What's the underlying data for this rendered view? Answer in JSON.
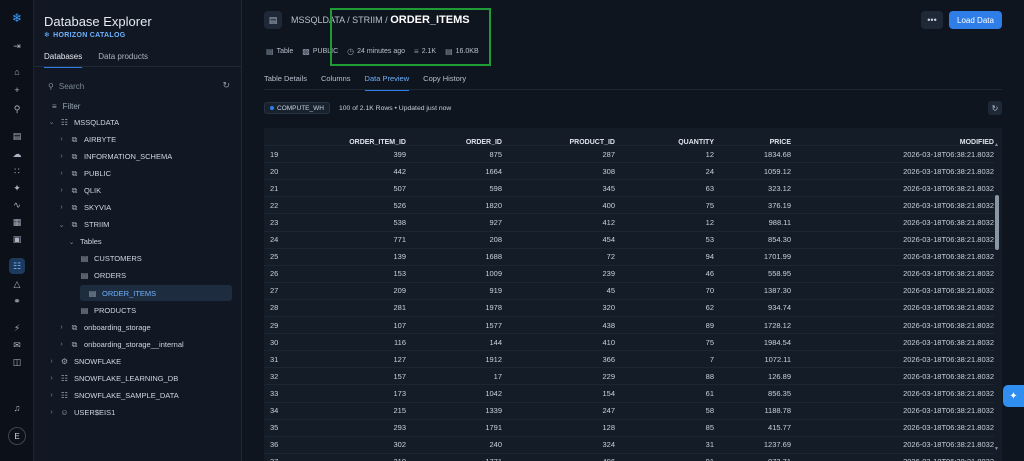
{
  "explorer": {
    "title": "Database Explorer",
    "catalog": "HORIZON CATALOG",
    "tabs": [
      "Databases",
      "Data products"
    ],
    "search_placeholder": "Search",
    "filter_label": "Filter",
    "tree": [
      {
        "label": "MSSQLDATA",
        "icon": "database-icon",
        "level": 0,
        "expanded": true
      },
      {
        "label": "AIRBYTE",
        "icon": "schema-icon",
        "level": 1,
        "expanded": false
      },
      {
        "label": "INFORMATION_SCHEMA",
        "icon": "schema-icon",
        "level": 1,
        "expanded": false
      },
      {
        "label": "PUBLIC",
        "icon": "schema-icon",
        "level": 1,
        "expanded": false
      },
      {
        "label": "QLIK",
        "icon": "schema-icon",
        "level": 1,
        "expanded": false
      },
      {
        "label": "SKYVIA",
        "icon": "schema-icon",
        "level": 1,
        "expanded": false
      },
      {
        "label": "STRIIM",
        "icon": "schema-icon",
        "level": 1,
        "expanded": true
      },
      {
        "label": "Tables",
        "icon": "",
        "level": 2,
        "expanded": true
      },
      {
        "label": "CUSTOMERS",
        "icon": "table-icon",
        "level": 3
      },
      {
        "label": "ORDERS",
        "icon": "table-icon",
        "level": 3
      },
      {
        "label": "ORDER_ITEMS",
        "icon": "table-icon",
        "level": 3,
        "selected": true
      },
      {
        "label": "PRODUCTS",
        "icon": "table-icon",
        "level": 3
      },
      {
        "label": "onboarding_storage",
        "icon": "schema-icon",
        "level": 1,
        "expanded": false
      },
      {
        "label": "onboarding_storage__internal",
        "icon": "schema-icon",
        "level": 1,
        "expanded": false
      },
      {
        "label": "SNOWFLAKE",
        "icon": "gear-icon",
        "level": 0,
        "expanded": false
      },
      {
        "label": "SNOWFLAKE_LEARNING_DB",
        "icon": "database-icon",
        "level": 0,
        "expanded": false
      },
      {
        "label": "SNOWFLAKE_SAMPLE_DATA",
        "icon": "database-icon",
        "level": 0,
        "expanded": false
      },
      {
        "label": "USER$EIS1",
        "icon": "user-icon",
        "level": 0,
        "expanded": false
      }
    ]
  },
  "rail": {
    "avatar_initial": "E"
  },
  "header": {
    "breadcrumb_path": "MSSQLDATA / STRIIM / ",
    "table_name": "ORDER_ITEMS",
    "meta": {
      "type": "Table",
      "schema": "PUBLIC",
      "updated": "24 minutes ago",
      "rows": "2.1K",
      "size": "16.0KB"
    },
    "more_label": "•••",
    "load_button": "Load Data"
  },
  "tabs": [
    "Table Details",
    "Columns",
    "Data Preview",
    "Copy History"
  ],
  "active_tab": "Data Preview",
  "preview": {
    "warehouse": "COMPUTE_WH",
    "rows_info": "100 of 2.1K Rows • Updated just now"
  },
  "grid": {
    "columns": [
      "",
      "ORDER_ITEM_ID",
      "ORDER_ID",
      "PRODUCT_ID",
      "QUANTITY",
      "PRICE",
      "MODIFIED"
    ],
    "rows": [
      [
        "19",
        "399",
        "875",
        "287",
        "12",
        "1834.68",
        "2026-03-18T06:38:21.8032"
      ],
      [
        "20",
        "442",
        "1664",
        "308",
        "24",
        "1059.12",
        "2026-03-18T06:38:21.8032"
      ],
      [
        "21",
        "507",
        "598",
        "345",
        "63",
        "323.12",
        "2026-03-18T06:38:21.8032"
      ],
      [
        "22",
        "526",
        "1820",
        "400",
        "75",
        "376.19",
        "2026-03-18T06:38:21.8032"
      ],
      [
        "23",
        "538",
        "927",
        "412",
        "12",
        "988.11",
        "2026-03-18T06:38:21.8032"
      ],
      [
        "24",
        "771",
        "208",
        "454",
        "53",
        "854.30",
        "2026-03-18T06:38:21.8032"
      ],
      [
        "25",
        "139",
        "1688",
        "72",
        "94",
        "1701.99",
        "2026-03-18T06:38:21.8032"
      ],
      [
        "26",
        "153",
        "1009",
        "239",
        "46",
        "558.95",
        "2026-03-18T06:38:21.8032"
      ],
      [
        "27",
        "209",
        "919",
        "45",
        "70",
        "1387.30",
        "2026-03-18T06:38:21.8032"
      ],
      [
        "28",
        "281",
        "1978",
        "320",
        "62",
        "934.74",
        "2026-03-18T06:38:21.8032"
      ],
      [
        "29",
        "107",
        "1577",
        "438",
        "89",
        "1728.12",
        "2026-03-18T06:38:21.8032"
      ],
      [
        "30",
        "116",
        "144",
        "410",
        "75",
        "1984.54",
        "2026-03-18T06:38:21.8032"
      ],
      [
        "31",
        "127",
        "1912",
        "366",
        "7",
        "1072.11",
        "2026-03-18T06:38:21.8032"
      ],
      [
        "32",
        "157",
        "17",
        "229",
        "88",
        "126.89",
        "2026-03-18T06:38:21.8032"
      ],
      [
        "33",
        "173",
        "1042",
        "154",
        "61",
        "856.35",
        "2026-03-18T06:38:21.8032"
      ],
      [
        "34",
        "215",
        "1339",
        "247",
        "58",
        "1188.78",
        "2026-03-18T06:38:21.8032"
      ],
      [
        "35",
        "293",
        "1791",
        "128",
        "85",
        "415.77",
        "2026-03-18T06:38:21.8032"
      ],
      [
        "36",
        "302",
        "240",
        "324",
        "31",
        "1237.69",
        "2026-03-18T06:38:21.8032"
      ],
      [
        "37",
        "310",
        "1771",
        "406",
        "91",
        "873.71",
        "2026-03-18T06:38:21.8032"
      ]
    ]
  },
  "colors": {
    "accent": "#2f7de8",
    "highlight_box": "#1f9c35",
    "background": "#0f151f"
  }
}
